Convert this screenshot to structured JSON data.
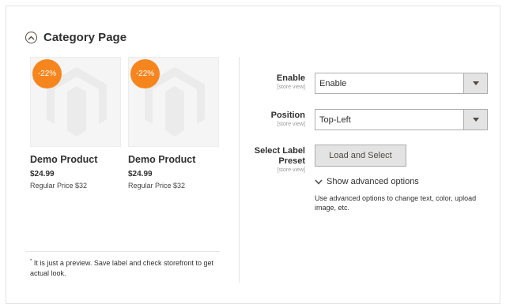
{
  "section": {
    "title": "Category Page"
  },
  "preview": {
    "products": [
      {
        "badge": "-22%",
        "name": "Demo Product",
        "price": "$24.99",
        "regular_price": "Regular Price $32"
      },
      {
        "badge": "-22%",
        "name": "Demo Product",
        "price": "$24.99",
        "regular_price": "Regular Price $32"
      }
    ],
    "note_mark": "*",
    "note": "It is just a preview. Save label and check storefront to get actual look."
  },
  "form": {
    "enable": {
      "label": "Enable",
      "scope": "[store view]",
      "value": "Enable"
    },
    "position": {
      "label": "Position",
      "scope": "[store view]",
      "value": "Top-Left"
    },
    "preset": {
      "label_line1": "Select Label",
      "label_line2": "Preset",
      "scope": "[store view]",
      "button": "Load and Select"
    },
    "advanced": {
      "toggle": "Show advanced options",
      "note": "Use advanced options to change text, color, upload image, etc."
    }
  },
  "colors": {
    "badge": "#f7851d",
    "button_bg": "#e3e3e3",
    "border": "#adadad"
  },
  "icons": {
    "collapse": "circle-chevron-up-icon",
    "select_arrow": "triangle-down-icon",
    "advanced_toggle": "chevron-down-icon",
    "placeholder": "magento-logo-icon"
  }
}
